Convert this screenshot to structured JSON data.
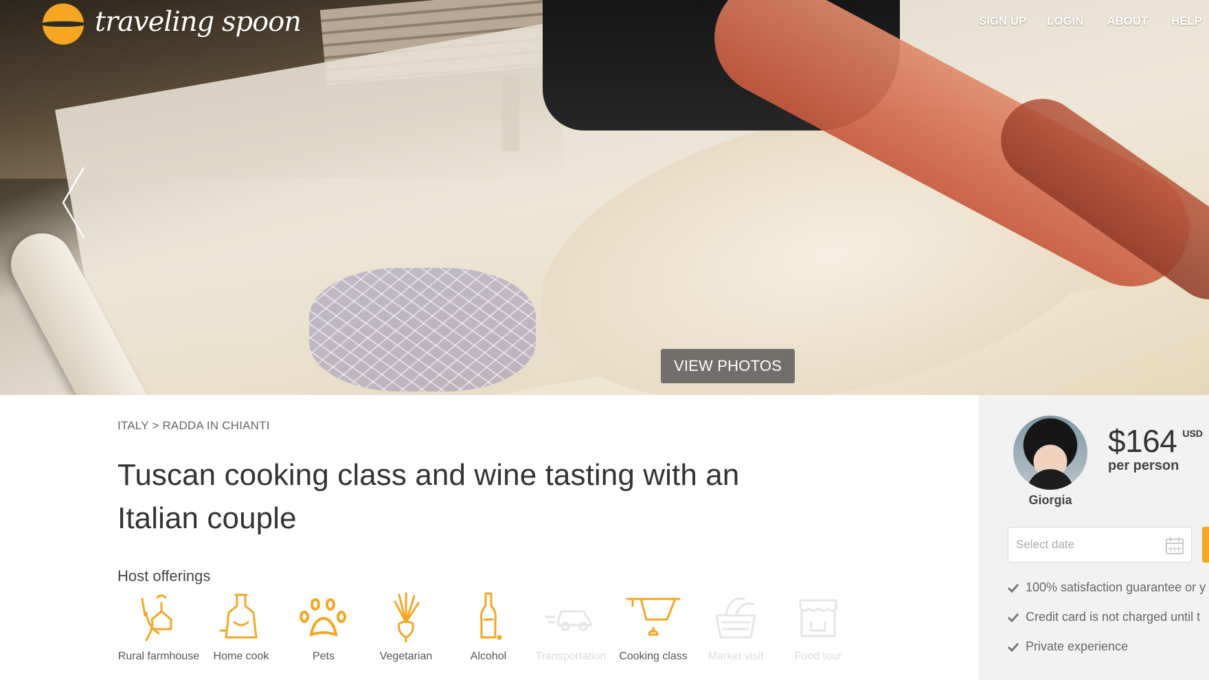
{
  "brand": {
    "logo_text": "traveling spoon",
    "accent": "#f5a623"
  },
  "nav": {
    "signup": "SIGN UP",
    "login": "LOGIN",
    "about": "ABOUT",
    "help": "HELP"
  },
  "hero": {
    "view_photos": "VIEW PHOTOS"
  },
  "breadcrumb": {
    "country": "ITALY",
    "separator": ">",
    "city": "RADDA IN CHIANTI"
  },
  "listing": {
    "title": "Tuscan cooking class and wine tasting with an Italian couple",
    "offerings_heading": "Host offerings",
    "offerings": [
      {
        "label": "Rural farmhouse",
        "icon": "farmhouse-icon",
        "active": true
      },
      {
        "label": "Home cook",
        "icon": "apron-icon",
        "active": true
      },
      {
        "label": "Pets",
        "icon": "paw-icon",
        "active": true
      },
      {
        "label": "Vegetarian",
        "icon": "vegetable-icon",
        "active": true
      },
      {
        "label": "Alcohol",
        "icon": "bottle-icon",
        "active": true
      },
      {
        "label": "Transportation",
        "icon": "car-icon",
        "active": false
      },
      {
        "label": "Cooking class",
        "icon": "cooking-pot-icon",
        "active": true
      },
      {
        "label": "Market visit",
        "icon": "market-basket-icon",
        "active": false
      },
      {
        "label": "Food tour",
        "icon": "food-stall-icon",
        "active": false
      }
    ]
  },
  "booking": {
    "host_name": "Giorgia",
    "price": "$164",
    "currency": "USD",
    "per": "per person",
    "date_placeholder": "Select date",
    "perks": [
      "100% satisfaction guarantee or y",
      "Credit card is not charged until t",
      "Private experience"
    ]
  }
}
